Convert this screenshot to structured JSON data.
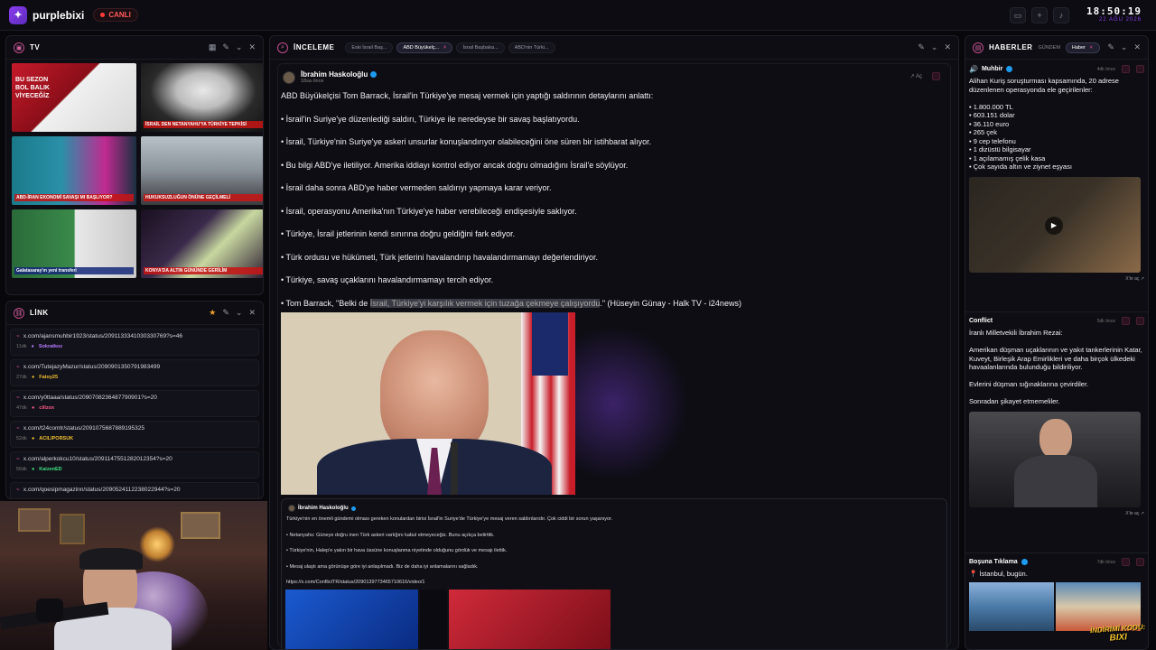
{
  "topbar": {
    "brand": "purplebixi",
    "live_label": "CANLI",
    "time": "18:50:19",
    "date": "22 AĞU 2026"
  },
  "tv": {
    "title": "TV",
    "channels": [
      {
        "caption": "",
        "overlay": "BU SEZON BOL BALIK VİYECEĞİZ"
      },
      {
        "caption": "İSRAİL DEN NETANYAHU'YA TÜRKİYE TEPKİSİ",
        "overlay": ""
      },
      {
        "caption": "ABD-İRAN EKONOMİ SAVAŞI MI BAŞLIYOR?",
        "overlay": ""
      },
      {
        "caption": "HUKUKSUZLUĞUN ÖNÜNE GEÇİLMELİ",
        "overlay": ""
      },
      {
        "caption": "Galatasaray'ın yeni transferi",
        "overlay": ""
      },
      {
        "caption": "KONYA'DA ALTIN GÜNÜNDE GERİLİM",
        "overlay": ""
      }
    ]
  },
  "link": {
    "title": "LİNK",
    "items": [
      {
        "url": "x.com/ajansmuhbir1923/status/2091133341030330769?s=46",
        "ago": "11dk",
        "user": "Sokratkoz",
        "color": "#b87aff"
      },
      {
        "url": "x.com/TutejazyMazur/status/2090901350791983499",
        "ago": "27dk",
        "user": "Fatoy25",
        "color": "#f0c030"
      },
      {
        "url": "x.com/y0ttaaa/status/2090708236487790901?s=20",
        "ago": "47dk",
        "user": "cillzox",
        "color": "#ff5a8a"
      },
      {
        "url": "x.com/t24comtr/status/2091075687889195325",
        "ago": "52dk",
        "user": "ACILIPORSUK",
        "color": "#f0c030"
      },
      {
        "url": "x.com/alperkokcu10/status/2091147551282012354?s=20",
        "ago": "56dk",
        "user": "KaizenED",
        "color": "#40e080"
      },
      {
        "url": "x.com/qoesipmagazinn/status/2090524112238022944?s=20",
        "ago": "",
        "user": "",
        "color": "#ffffff"
      }
    ]
  },
  "inceleme": {
    "title": "İNCELEME",
    "tabs": [
      "Eski İsrail Baş...",
      "ABD Büyükelç...",
      "İsrail Başbaka...",
      "ABD'nin Türki..."
    ],
    "author": "İbrahim Haskoloğlu",
    "ago": "18sa önce",
    "open_label": "Aç",
    "lines": [
      "ABD Büyükelçisi Tom Barrack, İsrail'in Türkiye'ye mesaj vermek için yaptığı saldırının detaylarını anlattı:",
      "• İsrail'in Suriye'ye düzenlediği saldırı, Türkiye ile neredeyse bir savaş başlatıyordu.",
      "• İsrail, Türkiye'nin Suriye'ye askeri unsurlar konuşlandırıyor olabileceğini öne süren bir istihbarat alıyor.",
      "• Bu bilgi ABD'ye iletiliyor. Amerika iddiayı kontrol ediyor ancak doğru olmadığını İsrail'e söylüyor.",
      "• İsrail daha sonra ABD'ye haber vermeden saldırıyı yapmaya karar veriyor.",
      "• İsrail, operasyonu Amerika'nın Türkiye'ye haber verebileceği endişesiyle saklıyor.",
      "• Türkiye, İsrail jetlerinin kendi sınırına doğru geldiğini fark ediyor.",
      "• Türk ordusu ve hükümeti, Türk jetlerini havalandırıp havalandırmamayı değerlendiriyor.",
      "• Türkiye, savaş uçaklarını havalandırmamayı tercih ediyor."
    ],
    "last_pre": "• Tom Barrack, \"Belki de ",
    "last_hl": "İsrail, Türkiye'yi karşılık vermek için tuzağa çekmeye çalışıyordu",
    "last_post": ".\" (Hüseyin Günay - Halk TV - i24news)",
    "quote": {
      "author": "İbrahim Haskoloğlu",
      "lines": [
        "Türkiye'nin en önemli gündemi olması gereken konulardan birisi İsrail'in Suriye'de Türkiye'ye mesaj veren saldırılarıdır. Çok ciddi bir sorun yaşanıyor.",
        "• Netanyahu: Güneye doğru inen Türk askeri varlığını kabul etmeyeceğiz. Bunu açıkça belirttik.",
        "• Türkiye'nin, Halep'e yakın bir hava üssüne konuşlanma niyetinde olduğunu gördük ve mesajı ilettik.",
        "• Mesaj ulaştı ama görünüşe göre iyi anlaşılmadı. Biz de daha iyi anlamalarını sağladık."
      ],
      "link": "https://x.com/ConflictTR/status/2090139773465710616/video/1"
    }
  },
  "haberler": {
    "title": "HABERLER",
    "tab_gundem": "GÜNDEM",
    "tab_haber": "Haber",
    "items": [
      {
        "name": "Muhbir",
        "ago": "4dk önce",
        "text": "Alihan Kuriş soruşturması kapsamında, 20 adrese düzenlenen operasyonda ele geçirilenler:\n\n• 1.800.000 TL\n• 603.151 dolar\n• 36.110 euro\n• 265 çek\n• 9 cep telefonu\n• 1 dizüstü bilgisayar\n• 1 açılamamış çelik kasa\n• Çok sayıda altın ve ziynet eşyası",
        "xlink": "X'te aç ↗"
      },
      {
        "name": "Conflict",
        "ago": "5dk önce",
        "text": "İranlı Milletvekili İbrahim Rezai:\n\nAmerikan düşman uçaklarının ve yakıt tankerlerinin Katar, Kuveyt, Birleşik Arap Emirlikleri ve daha birçok ülkedeki havaalanlarında bulunduğu bildiriliyor.\n\nEvlerini düşman sığınaklarına çevirdiler.\n\nSonradan şikayet etmemeliler.",
        "xlink": "X'te aç ↗"
      },
      {
        "name": "Boşuna Tıklama",
        "ago": "7dk önce",
        "text": "📍 İstanbul, bugün.",
        "xlink": ""
      }
    ]
  },
  "overlay": {
    "line1": "İNDİRİMİ KODU:",
    "line2": "BIXI"
  }
}
